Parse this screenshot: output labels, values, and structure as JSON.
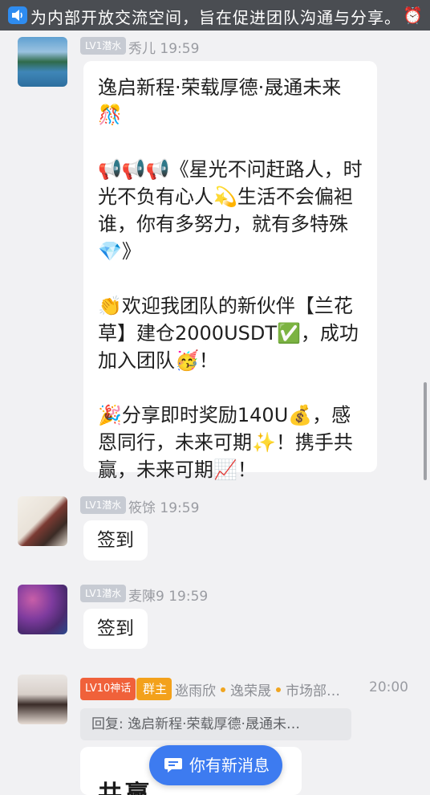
{
  "announcement": {
    "text": "为内部开放交流空间，旨在促进团队沟通与分享。",
    "icon": "speaker-icon",
    "trailing_icon": "alarm-clock-icon"
  },
  "messages": [
    {
      "level": "LV1潜水",
      "sender": "秀儿",
      "time": "19:59",
      "lines": [
        "逸启新程·荣载厚德·晟通未来 🎊",
        "📢📢📢《星光不问赶路人，时光不负有心人💫生活不会偏袒谁，你有多努力，就有多特殊💎》",
        "👏欢迎我团队的新伙伴【兰花草】建仓2000USDT✅，成功加入团队🥳！",
        "🎉分享即时奖励140U💰，感恩同行，未来可期✨！携手共赢，未来可期📈！"
      ]
    },
    {
      "level": "LV1潜水",
      "sender": "筱馀",
      "time": "19:59",
      "text": "签到"
    },
    {
      "level": "LV1潜水",
      "sender": "麦陳9",
      "time": "19:59",
      "text": "签到"
    },
    {
      "level": "LV10神话",
      "role": "群主",
      "sender": "逖雨欣",
      "tag1": "逸荣晟",
      "tag2": "市场部…",
      "time": "20:00",
      "reply": "回复: 逸启新程·荣载厚德·晟通未…",
      "partial_text": "共赢"
    }
  ],
  "new_message_button": {
    "label": "你有新消息",
    "icon": "chat-bubble-icon"
  },
  "colors": {
    "accent": "#3d7bf0",
    "notice_bg": "#4a4d52",
    "lv10": "#f0613a",
    "owner": "#f3a11b"
  }
}
